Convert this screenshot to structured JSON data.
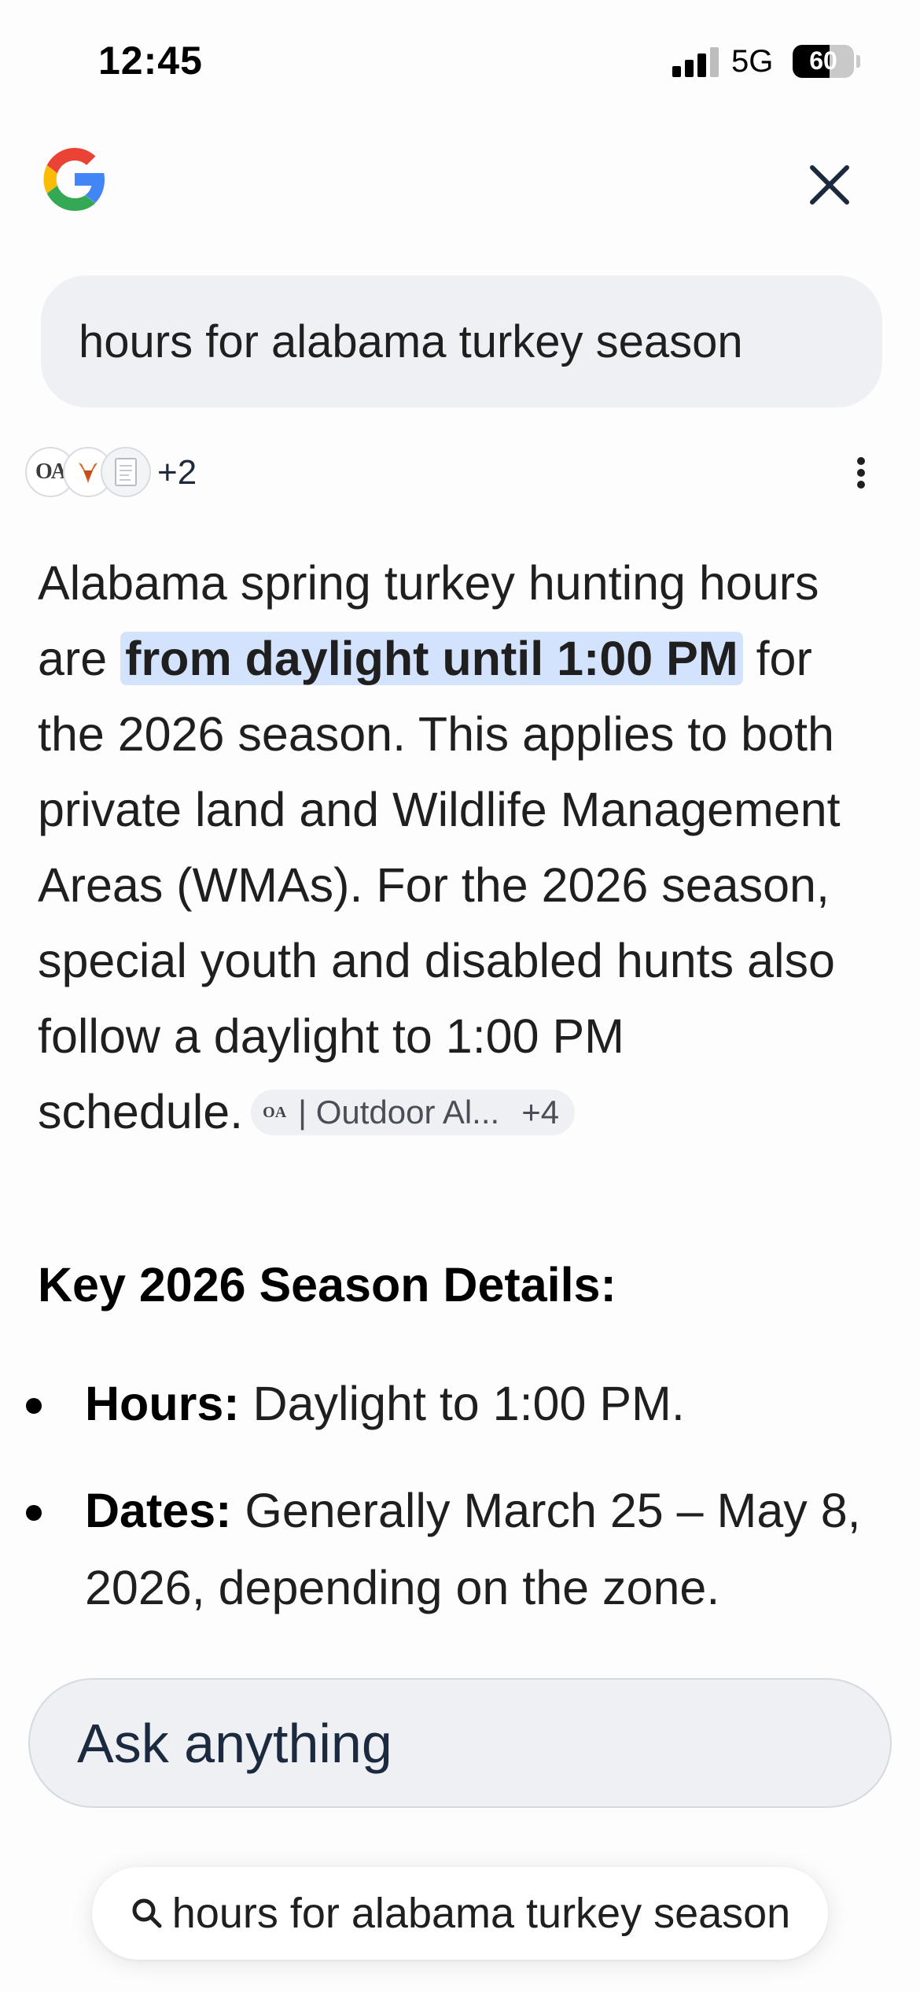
{
  "status_bar": {
    "time": "12:45",
    "network": "5G",
    "battery": "60",
    "battery_level": 0.6
  },
  "header": {
    "logo_icon": "google-g-icon",
    "close_icon": "close-icon"
  },
  "query": {
    "text": "hours for alabama turkey season"
  },
  "sources": {
    "icons": [
      "outdoor-alabama-logo-icon",
      "deer-logo-icon",
      "document-icon"
    ],
    "oa_text": "OA",
    "extra_count": "+2"
  },
  "answer": {
    "p1": "Alabama spring turkey hunting hours are ",
    "highlight_normal": "from ",
    "highlight_bold": "daylight until 1:00 PM",
    "p2": " for the 2026 season. This applies to both private land and Wildlife Management Areas (WMAs). For the 2026 season, special youth and disabled hunts also follow a daylight to 1:00 PM",
    "p3": "schedule.",
    "citation": {
      "icon_text": "OA",
      "label": "| Outdoor Al...",
      "count": "+4"
    }
  },
  "key_details": {
    "heading": "Key 2026 Season Details:",
    "items": [
      {
        "label": "Hours:",
        "text": " Daylight to 1:00 PM."
      },
      {
        "label": "Dates:",
        "text": " Generally March 25 – May 8, 2026, depending on the zone."
      }
    ]
  },
  "composer": {
    "placeholder": "Ask anything"
  },
  "search_chip": {
    "icon": "search-icon",
    "text": "hours for alabama turkey season"
  },
  "colors": {
    "highlight": "#d3e3fd",
    "bubble": "#eef0f4",
    "google_blue": "#4285F4",
    "google_red": "#EA4335",
    "google_yellow": "#FBBC05",
    "google_green": "#34A853"
  }
}
